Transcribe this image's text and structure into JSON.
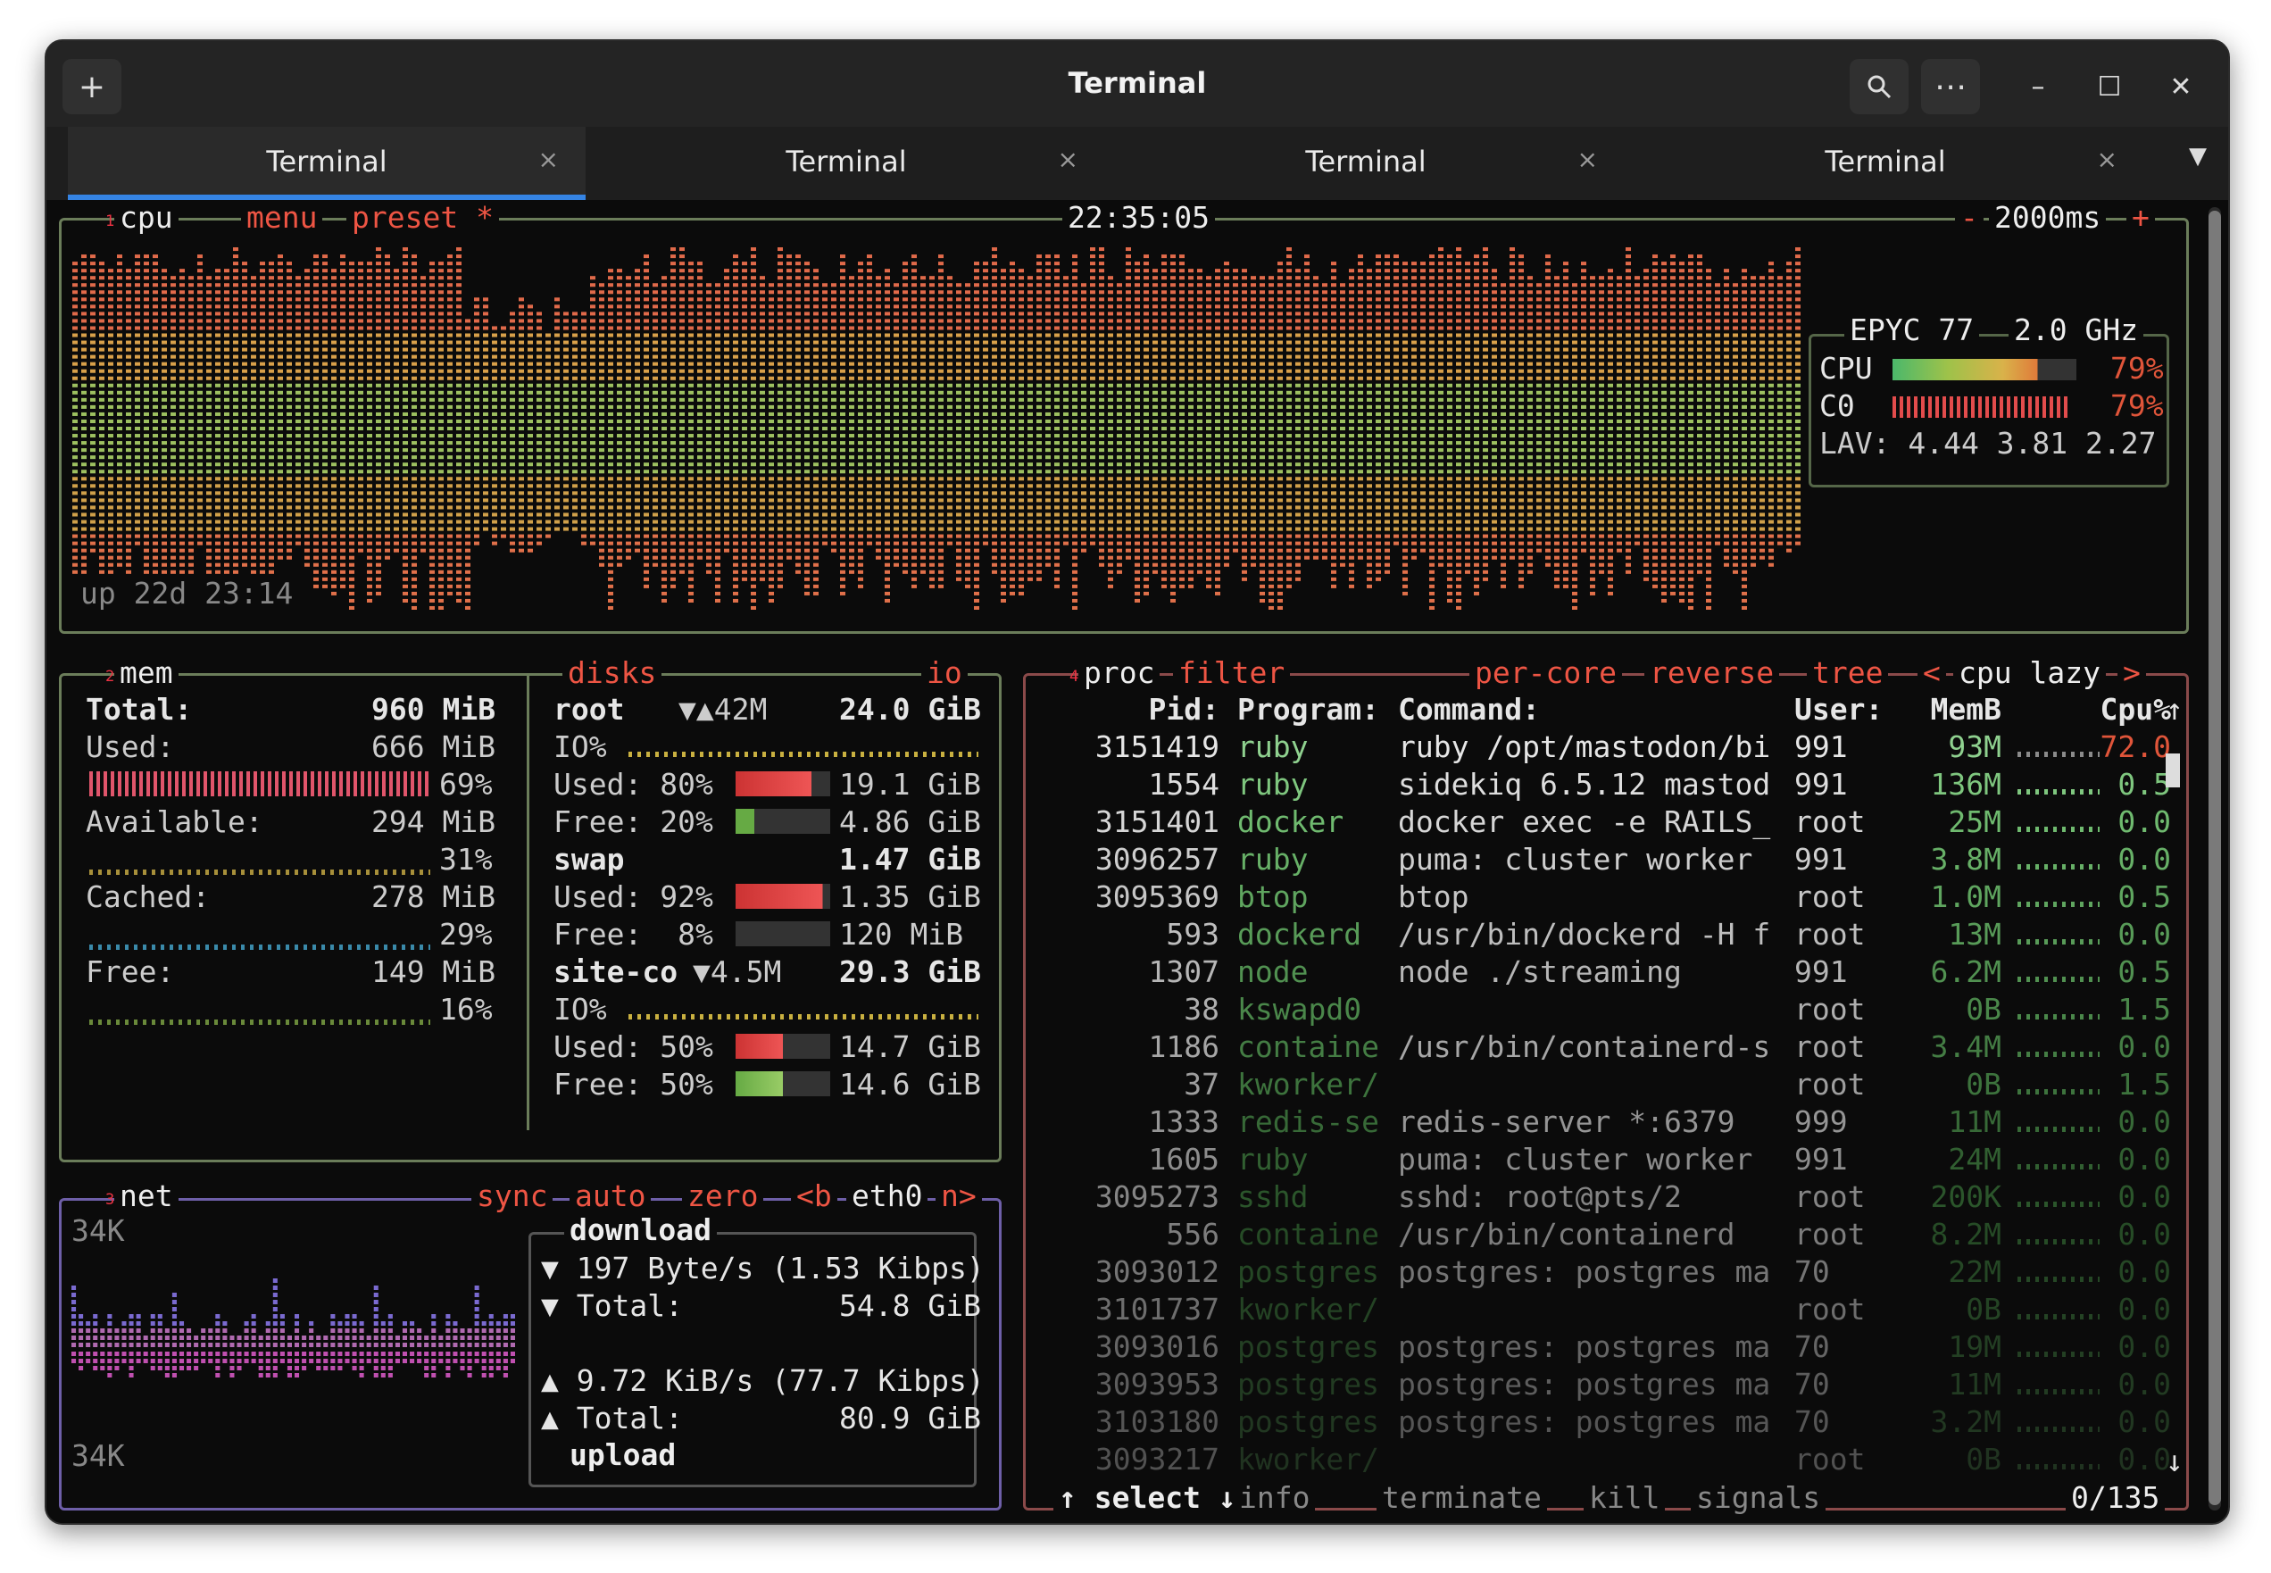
{
  "window": {
    "title": "Terminal",
    "tabs": [
      {
        "label": "Terminal",
        "active": true
      },
      {
        "label": "Terminal",
        "active": false
      },
      {
        "label": "Terminal",
        "active": false
      },
      {
        "label": "Terminal",
        "active": false
      }
    ],
    "new_tab_icon": "plus-icon",
    "search_icon": "search-icon",
    "menu_icon": "ellipsis-icon",
    "close_glyph": "×"
  },
  "cpu": {
    "num": "1",
    "label": "cpu",
    "menu": "menu",
    "preset": "preset *",
    "clock": "22:35:05",
    "interval": "2000ms",
    "minus": "-",
    "plus": "+",
    "uptime": "up 22d 23:14",
    "model": "EPYC 77",
    "freq": "2.0 GHz",
    "cpu_label": "CPU",
    "cpu_pct": "79%",
    "core_label": "C0",
    "core_pct": "79%",
    "lav": "LAV: 4.44 3.81 2.27"
  },
  "mem": {
    "num": "2",
    "label": "mem",
    "total_label": "Total:",
    "total": "960 MiB",
    "used_label": "Used:",
    "used": "666 MiB",
    "used_pct": "69%",
    "avail_label": "Available:",
    "avail": "294 MiB",
    "avail_pct": "31%",
    "cached_label": "Cached:",
    "cached": "278 MiB",
    "cached_pct": "29%",
    "free_label": "Free:",
    "free": "149 MiB",
    "free_pct": "16%"
  },
  "disks": {
    "label": "disks",
    "io": "io",
    "root_name": "root",
    "root_io": "▼▲42M",
    "root_size": "24.0 GiB",
    "root_io_label": "IO%",
    "root_used_label": "Used: 80%",
    "root_used": "19.1 GiB",
    "root_free_label": "Free: 20%",
    "root_free": "4.86 GiB",
    "swap_name": "swap",
    "swap_size": "1.47 GiB",
    "swap_used_label": "Used: 92%",
    "swap_used": "1.35 GiB",
    "swap_free_label": "Free:  8%",
    "swap_free": "120 MiB",
    "site_name": "site-co",
    "site_io": "▼4.5M",
    "site_size": "29.3 GiB",
    "site_io_label": "IO%",
    "site_used_label": "Used: 50%",
    "site_used": "14.7 GiB",
    "site_free_label": "Free: 50%",
    "site_free": "14.6 GiB"
  },
  "net": {
    "num": "3",
    "label": "net",
    "sync": "sync",
    "auto": "auto",
    "zero": "zero",
    "iface_prev": "<b",
    "iface": "eth0",
    "iface_next": "n>",
    "scale_top": "34K",
    "scale_bottom": "34K",
    "download_label": "download",
    "dl_rate": "▼ 197 Byte/s (1.53 Kibps)",
    "dl_total_label": "▼ Total:",
    "dl_total": "54.8 GiB",
    "ul_rate": "▲ 9.72 KiB/s (77.7 Kibps)",
    "ul_total_label": "▲ Total:",
    "ul_total": "80.9 GiB",
    "upload_label": "upload"
  },
  "proc": {
    "num": "4",
    "label": "proc",
    "filter": "filter",
    "per_core": "per-core",
    "reverse": "reverse",
    "tree": "tree",
    "sort_prev": "<",
    "sort": "cpu lazy",
    "sort_next": ">",
    "headers": {
      "pid": "Pid:",
      "program": "Program:",
      "command": "Command:",
      "user": "User:",
      "mem": "MemB",
      "cpu": "Cpu%"
    },
    "rows": [
      {
        "pid": "3151419",
        "program": "ruby",
        "command": "ruby /opt/mastodon/bi",
        "user": "991",
        "mem": "93M",
        "cpu": "72.0"
      },
      {
        "pid": "1554",
        "program": "ruby",
        "command": "sidekiq 6.5.12 mastod",
        "user": "991",
        "mem": "136M",
        "cpu": "0.5"
      },
      {
        "pid": "3151401",
        "program": "docker",
        "command": "docker exec -e RAILS_",
        "user": "root",
        "mem": "25M",
        "cpu": "0.0"
      },
      {
        "pid": "3096257",
        "program": "ruby",
        "command": "puma: cluster worker",
        "user": "991",
        "mem": "3.8M",
        "cpu": "0.0"
      },
      {
        "pid": "3095369",
        "program": "btop",
        "command": "btop",
        "user": "root",
        "mem": "1.0M",
        "cpu": "0.5"
      },
      {
        "pid": "593",
        "program": "dockerd",
        "command": "/usr/bin/dockerd -H f",
        "user": "root",
        "mem": "13M",
        "cpu": "0.0"
      },
      {
        "pid": "1307",
        "program": "node",
        "command": "node ./streaming",
        "user": "991",
        "mem": "6.2M",
        "cpu": "0.5"
      },
      {
        "pid": "38",
        "program": "kswapd0",
        "command": "",
        "user": "root",
        "mem": "0B",
        "cpu": "1.5"
      },
      {
        "pid": "1186",
        "program": "containe",
        "command": "/usr/bin/containerd-s",
        "user": "root",
        "mem": "3.4M",
        "cpu": "0.0"
      },
      {
        "pid": "37",
        "program": "kworker/",
        "command": "",
        "user": "root",
        "mem": "0B",
        "cpu": "1.5"
      },
      {
        "pid": "1333",
        "program": "redis-se",
        "command": "redis-server *:6379",
        "user": "999",
        "mem": "11M",
        "cpu": "0.0"
      },
      {
        "pid": "1605",
        "program": "ruby",
        "command": "puma: cluster worker",
        "user": "991",
        "mem": "24M",
        "cpu": "0.0"
      },
      {
        "pid": "3095273",
        "program": "sshd",
        "command": "sshd: root@pts/2",
        "user": "root",
        "mem": "200K",
        "cpu": "0.0"
      },
      {
        "pid": "556",
        "program": "containe",
        "command": "/usr/bin/containerd",
        "user": "root",
        "mem": "8.2M",
        "cpu": "0.0"
      },
      {
        "pid": "3093012",
        "program": "postgres",
        "command": "postgres: postgres ma",
        "user": "70",
        "mem": "22M",
        "cpu": "0.0"
      },
      {
        "pid": "3101737",
        "program": "kworker/",
        "command": "",
        "user": "root",
        "mem": "0B",
        "cpu": "0.0"
      },
      {
        "pid": "3093016",
        "program": "postgres",
        "command": "postgres: postgres ma",
        "user": "70",
        "mem": "19M",
        "cpu": "0.0"
      },
      {
        "pid": "3093953",
        "program": "postgres",
        "command": "postgres: postgres ma",
        "user": "70",
        "mem": "11M",
        "cpu": "0.0"
      },
      {
        "pid": "3103180",
        "program": "postgres",
        "command": "postgres: postgres ma",
        "user": "70",
        "mem": "3.2M",
        "cpu": "0.0"
      },
      {
        "pid": "3093217",
        "program": "kworker/",
        "command": "",
        "user": "root",
        "mem": "0B",
        "cpu": "0.0"
      }
    ],
    "footer_select": "↑ select ↓",
    "footer_info": "info",
    "footer_terminate": "terminate",
    "footer_kill": "kill",
    "footer_signals": "signals",
    "count": "0/135"
  },
  "colors": {
    "accent": "#3584e4",
    "cpu_box": "#6b7d5a",
    "net_box": "#6e5fa8",
    "proc_box": "#8b4a4a",
    "hotkey": "#e54a3a"
  }
}
